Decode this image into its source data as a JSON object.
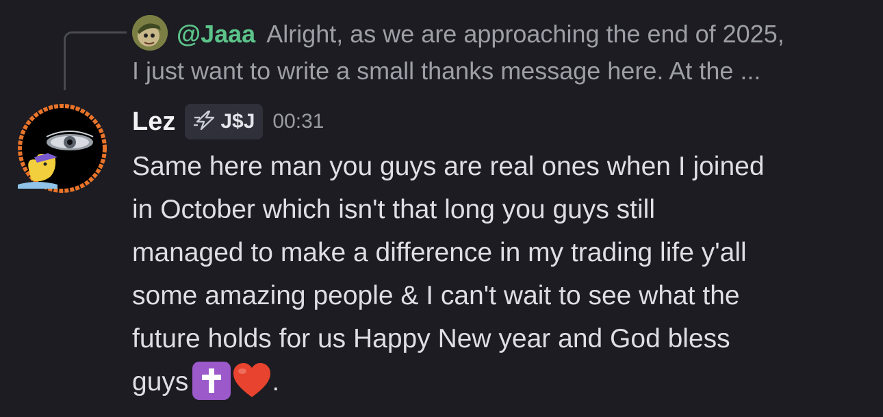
{
  "reply": {
    "username": "@Jaaa",
    "preview_line1": "Alright, as we are approaching the end of 2025,",
    "preview_line2": "I just want to write a small thanks message here. At the ..."
  },
  "message": {
    "author": "Lez",
    "role_tag": "J$J",
    "timestamp": "00:31",
    "lines": [
      "Same here man you guys are real ones when I joined",
      "in October which isn't that long you guys still",
      "managed to make a difference in my trading life y'all",
      "some amazing people & I can't wait to see what the",
      "future holds for us Happy New year and God bless",
      "guys"
    ],
    "trailing_punctuation": ".",
    "emojis": [
      "cross-emoji",
      "red-heart-emoji"
    ]
  },
  "colors": {
    "background": "#1c1c22",
    "reply_username": "#5cc48a",
    "author_name": "#f2f2f5",
    "muted_text": "#9e9ea6",
    "body_text": "#dedee4",
    "role_tag_bg": "#2f3039"
  },
  "icons": {
    "role_tag_icon": "lightning-icon"
  }
}
